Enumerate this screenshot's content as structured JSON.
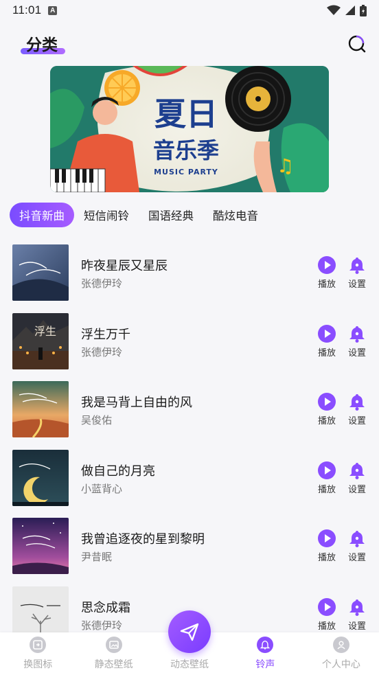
{
  "status": {
    "time": "11:01"
  },
  "header": {
    "title": "分类"
  },
  "tabs": [
    {
      "label": "抖音新曲",
      "active": true
    },
    {
      "label": "短信闹铃",
      "active": false
    },
    {
      "label": "国语经典",
      "active": false
    },
    {
      "label": "酷炫电音",
      "active": false
    }
  ],
  "actions": {
    "play_label": "播放",
    "set_label": "设置"
  },
  "songs": [
    {
      "title": "昨夜星辰又星辰",
      "artist": "张德伊玲"
    },
    {
      "title": "浮生万千",
      "artist": "张德伊玲"
    },
    {
      "title": "我是马背上自由的风",
      "artist": "吴俊佑"
    },
    {
      "title": "做自己的月亮",
      "artist": "小蓝背心"
    },
    {
      "title": "我曾追逐夜的星到黎明",
      "artist": "尹昔眠"
    },
    {
      "title": "思念成霜",
      "artist": "张德伊玲"
    }
  ],
  "nav": [
    {
      "label": "换图标",
      "icon": "swap-icon"
    },
    {
      "label": "静态壁纸",
      "icon": "image-icon"
    },
    {
      "label": "动态壁纸",
      "icon": "paper-plane-icon"
    },
    {
      "label": "铃声",
      "icon": "bell-icon"
    },
    {
      "label": "个人中心",
      "icon": "user-icon"
    }
  ],
  "colors": {
    "accent": "#8a4dff",
    "tab_active_start": "#7a4cff",
    "tab_active_end": "#a65cff"
  }
}
